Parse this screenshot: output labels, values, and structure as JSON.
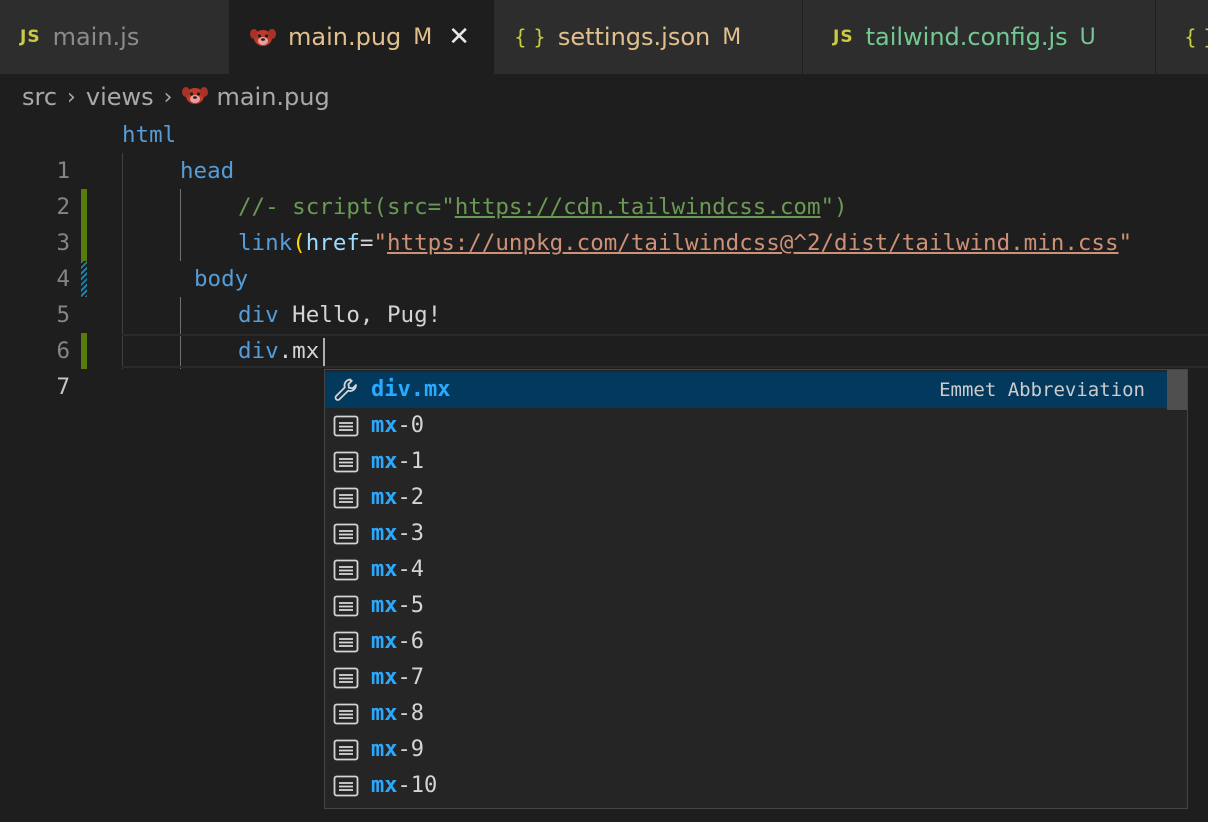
{
  "tabs": [
    {
      "icon": "javascript-file-icon",
      "icon_text": "JS",
      "label": "main.js",
      "status": "",
      "active": false
    },
    {
      "icon": "pug-file-icon",
      "icon_text": "",
      "label": "main.pug",
      "status": "M",
      "active": true
    },
    {
      "icon": "json-file-icon",
      "icon_text": "{ }",
      "label": "settings.json",
      "status": "M",
      "active": false
    },
    {
      "icon": "javascript-file-icon",
      "icon_text": "JS",
      "label": "tailwind.config.js",
      "status": "U",
      "active": false
    },
    {
      "icon": "json-file-icon",
      "icon_text": "{ }",
      "label": "",
      "status": "",
      "active": false
    }
  ],
  "breadcrumb": {
    "items": [
      "src",
      "views",
      "main.pug"
    ],
    "separator": ">"
  },
  "editor": {
    "line_numbers": [
      "1",
      "2",
      "3",
      "4",
      "5",
      "6",
      "7"
    ],
    "active_line": "7",
    "lines": [
      {
        "tokens": [
          {
            "t": "tag",
            "v": "html"
          }
        ]
      },
      {
        "tokens": [
          {
            "t": "tag",
            "v": "head"
          }
        ]
      },
      {
        "tokens": [
          {
            "t": "comment",
            "v": "//- script(src=\""
          },
          {
            "t": "link-c",
            "v": "https://cdn.tailwindcss.com"
          },
          {
            "t": "comment",
            "v": "\")"
          }
        ]
      },
      {
        "tokens": [
          {
            "t": "tag",
            "v": "link"
          },
          {
            "t": "paren",
            "v": "("
          },
          {
            "t": "attr",
            "v": "href"
          },
          {
            "t": "plain",
            "v": "="
          },
          {
            "t": "string",
            "v": "\""
          },
          {
            "t": "link-s",
            "v": "https://unpkg.com/tailwindcss@^2/dist/tailwind.min.css"
          },
          {
            "t": "string",
            "v": "\""
          }
        ]
      },
      {
        "tokens": [
          {
            "t": "tag",
            "v": "body"
          }
        ]
      },
      {
        "tokens": [
          {
            "t": "tag",
            "v": "div"
          },
          {
            "t": "plain",
            "v": " Hello, Pug!"
          }
        ]
      },
      {
        "tokens": [
          {
            "t": "tag",
            "v": "div"
          },
          {
            "t": "plain",
            "v": ".mx"
          }
        ]
      }
    ]
  },
  "suggestions": {
    "items": [
      {
        "icon": "wrench-icon",
        "label": "div.mx",
        "match": "",
        "rest": "",
        "detail": "Emmet Abbreviation",
        "selected": true
      },
      {
        "icon": "text-snippet-icon",
        "label": "mx-0",
        "match": "mx",
        "rest": "-0",
        "detail": "",
        "selected": false
      },
      {
        "icon": "text-snippet-icon",
        "label": "mx-1",
        "match": "mx",
        "rest": "-1",
        "detail": "",
        "selected": false
      },
      {
        "icon": "text-snippet-icon",
        "label": "mx-2",
        "match": "mx",
        "rest": "-2",
        "detail": "",
        "selected": false
      },
      {
        "icon": "text-snippet-icon",
        "label": "mx-3",
        "match": "mx",
        "rest": "-3",
        "detail": "",
        "selected": false
      },
      {
        "icon": "text-snippet-icon",
        "label": "mx-4",
        "match": "mx",
        "rest": "-4",
        "detail": "",
        "selected": false
      },
      {
        "icon": "text-snippet-icon",
        "label": "mx-5",
        "match": "mx",
        "rest": "-5",
        "detail": "",
        "selected": false
      },
      {
        "icon": "text-snippet-icon",
        "label": "mx-6",
        "match": "mx",
        "rest": "-6",
        "detail": "",
        "selected": false
      },
      {
        "icon": "text-snippet-icon",
        "label": "mx-7",
        "match": "mx",
        "rest": "-7",
        "detail": "",
        "selected": false
      },
      {
        "icon": "text-snippet-icon",
        "label": "mx-8",
        "match": "mx",
        "rest": "-8",
        "detail": "",
        "selected": false
      },
      {
        "icon": "text-snippet-icon",
        "label": "mx-9",
        "match": "mx",
        "rest": "-9",
        "detail": "",
        "selected": false
      },
      {
        "icon": "text-snippet-icon",
        "label": "mx-10",
        "match": "mx",
        "rest": "-10",
        "detail": "",
        "selected": false
      }
    ]
  },
  "colors": {
    "background": "#1e1e1e",
    "tag": "#569cd6",
    "comment": "#6a9955",
    "string": "#ce9178",
    "modified": "#e2c08d",
    "untracked": "#73c991",
    "suggest_highlight": "#2aaaff",
    "selected_row": "#04395e",
    "git_added": "#587c0c"
  }
}
